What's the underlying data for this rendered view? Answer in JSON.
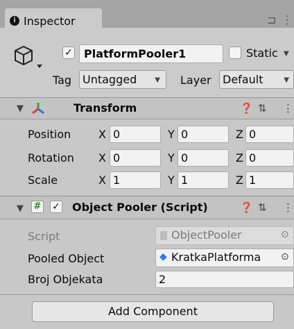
{
  "window": {
    "tab_label": "Inspector"
  },
  "gameobject": {
    "active_checked": true,
    "name": "PlatformPooler1",
    "static_label": "Static",
    "tag_label": "Tag",
    "tag_value": "Untagged",
    "layer_label": "Layer",
    "layer_value": "Default"
  },
  "transform": {
    "title": "Transform",
    "rows": [
      {
        "label": "Position",
        "x": "0",
        "y": "0",
        "z": "0"
      },
      {
        "label": "Rotation",
        "x": "0",
        "y": "0",
        "z": "0"
      },
      {
        "label": "Scale",
        "x": "1",
        "y": "1",
        "z": "1"
      }
    ],
    "axes": {
      "x": "X",
      "y": "Y",
      "z": "Z"
    }
  },
  "object_pooler": {
    "enabled": true,
    "title": "Object Pooler (Script)",
    "script_label": "Script",
    "script_value": "ObjectPooler",
    "pooled_label": "Pooled Object",
    "pooled_value": "KratkaPlatforma",
    "count_label": "Broj Objekata",
    "count_value": "2"
  },
  "footer": {
    "add_component": "Add Component"
  },
  "colors": {
    "prefab_blue": "#2b7fd6",
    "transform_red": "#d83b3b",
    "transform_green": "#3aa53a",
    "transform_blue": "#3b6fd8"
  }
}
